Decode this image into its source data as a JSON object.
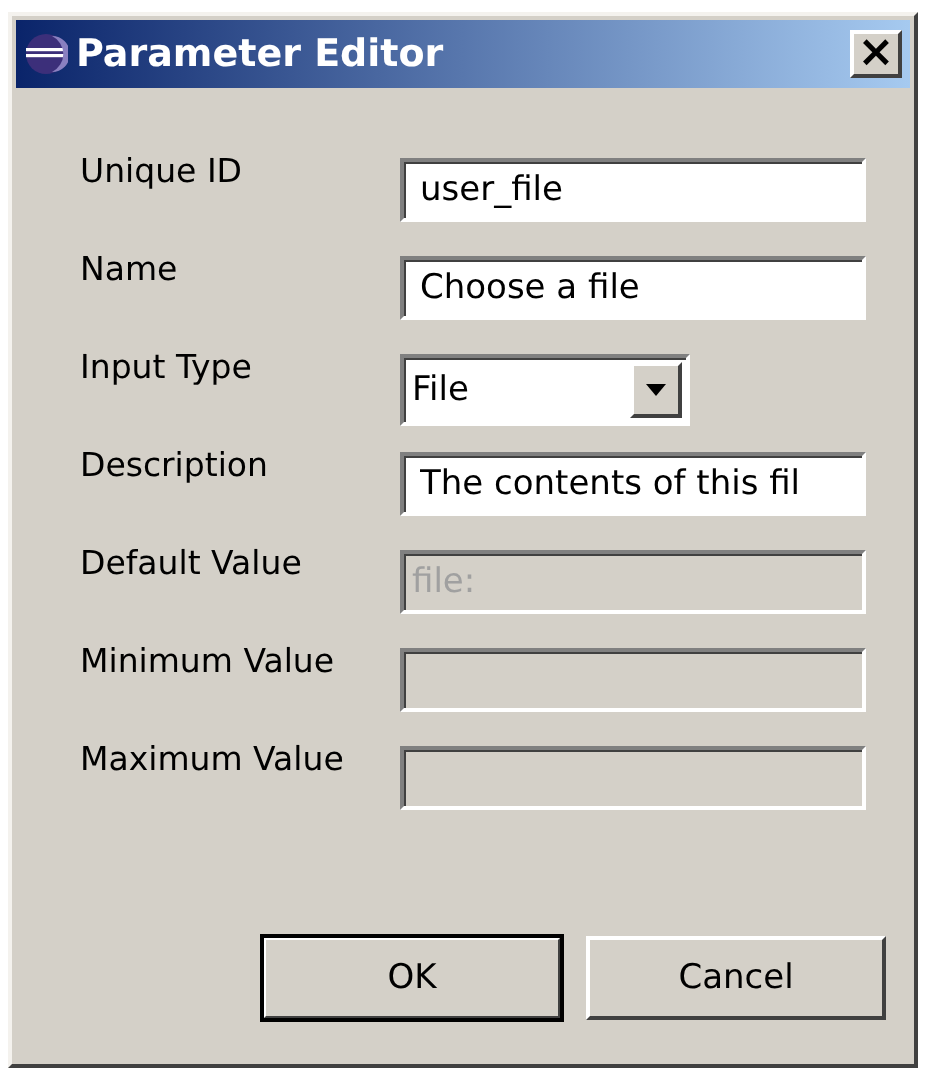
{
  "window": {
    "title": "Parameter Editor",
    "close": "×"
  },
  "fields": [
    {
      "label": "Unique ID",
      "kind": "text",
      "value": "user_file",
      "disabled": false
    },
    {
      "label": "Name",
      "kind": "text",
      "value": "Choose a file",
      "disabled": false
    },
    {
      "label": "Input Type",
      "kind": "select",
      "value": "File"
    },
    {
      "label": "Description",
      "kind": "text",
      "value": "The contents of this fil",
      "disabled": false
    },
    {
      "label": "Default Value",
      "kind": "text",
      "value": "file:",
      "disabled": true
    },
    {
      "label": "Minimum Value",
      "kind": "text",
      "disabled": true
    },
    {
      "label": "Maximum Value",
      "kind": "text",
      "disabled": true
    }
  ],
  "buttons": [
    {
      "label": "OK",
      "default": true
    },
    {
      "label": "Cancel",
      "default": false
    }
  ]
}
